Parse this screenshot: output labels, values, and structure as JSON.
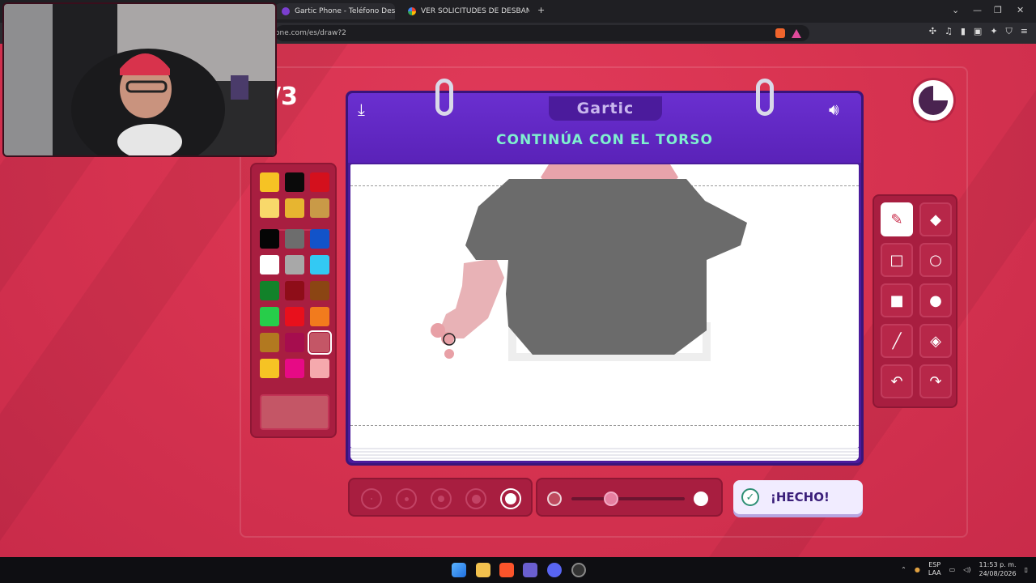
{
  "browser": {
    "tabs": [
      {
        "title": "Gartic Phone - Teléfono Descom",
        "active": true
      },
      {
        "title": "VER SOLICITUDES DE DESBANEO EN",
        "active": false
      }
    ],
    "new_tab": "+",
    "url": "one.com/es/draw?2"
  },
  "game": {
    "round": "/3",
    "logo": "Gartic",
    "prompt": "CONTINÚA CON EL TORSO",
    "download_icon": "download-icon",
    "sound_icon": "speaker-icon",
    "done_label": "¡HECHO!",
    "timer_remaining_fraction": 0.75
  },
  "palette": {
    "rows": [
      [
        "#f6c324",
        "#0a0a0a",
        "#d4101d"
      ],
      [
        "#f8d86a",
        "#e7b530",
        "#c99a47"
      ],
      [
        "#050505",
        "#6d6d6d",
        "#1253c9"
      ],
      [
        "#ffffff",
        "#a8a8a8",
        "#33c9f3"
      ],
      [
        "#12822a",
        "#8e0d18",
        "#8b4513"
      ],
      [
        "#27cd4a",
        "#e8101c",
        "#f27b1d"
      ],
      [
        "#b27920",
        "#a60d4e",
        "#c45666"
      ],
      [
        "#f6c324",
        "#e70a85",
        "#f5a9ad"
      ]
    ],
    "selected": "#c45666"
  },
  "tools": [
    {
      "name": "pencil-icon",
      "glyph": "✎",
      "selected": true
    },
    {
      "name": "eraser-icon",
      "glyph": "◆",
      "selected": false
    },
    {
      "name": "rectangle-outline-icon",
      "glyph": "□",
      "selected": false
    },
    {
      "name": "ellipse-outline-icon",
      "glyph": "○",
      "selected": false
    },
    {
      "name": "rectangle-filled-icon",
      "glyph": "■",
      "selected": false
    },
    {
      "name": "ellipse-filled-icon",
      "glyph": "●",
      "selected": false
    },
    {
      "name": "line-icon",
      "glyph": "╱",
      "selected": false
    },
    {
      "name": "fill-bucket-icon",
      "glyph": "◈",
      "selected": false
    },
    {
      "name": "undo-icon",
      "glyph": "↶",
      "selected": false
    },
    {
      "name": "redo-icon",
      "glyph": "↷",
      "selected": false
    }
  ],
  "brush": {
    "sizes": 5,
    "selected_size_index": 4,
    "opacity_fraction": 0.35
  },
  "taskbar": {
    "lang": "ESP",
    "lang2": "LAA",
    "time": "11:53 p. m.",
    "date": "24/08/2026"
  }
}
